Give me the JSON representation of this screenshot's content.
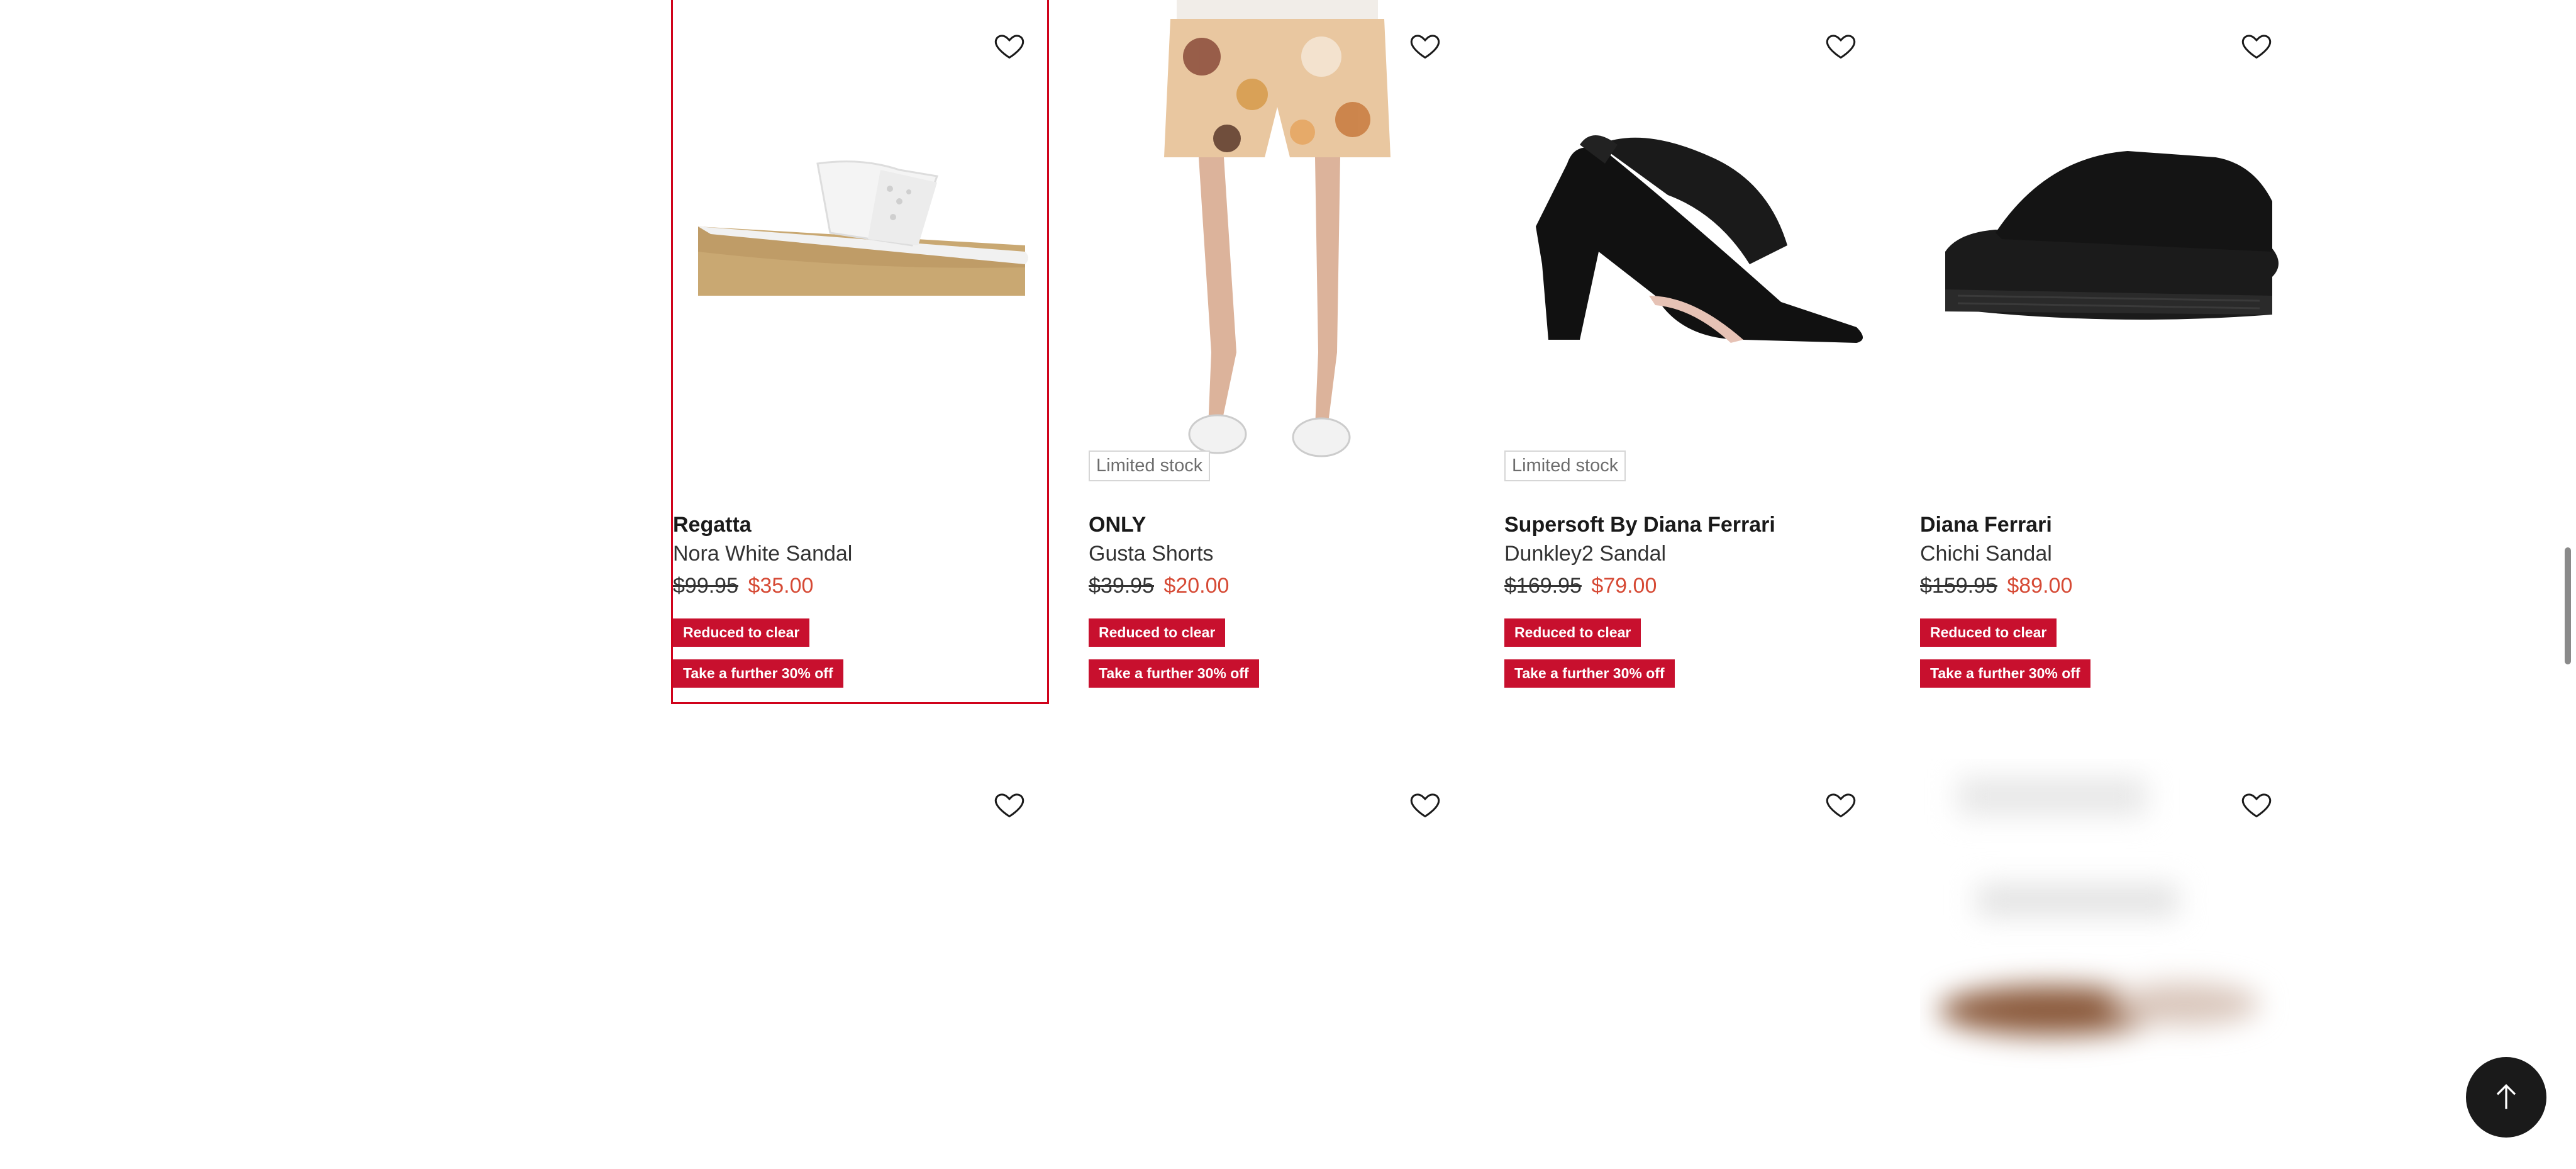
{
  "products": [
    {
      "brand": "Regatta",
      "name": "Nora White Sandal",
      "was": "$99.95",
      "now": "$35.00",
      "limited": "",
      "badges": [
        "Reduced to clear",
        "Take a further 30% off"
      ]
    },
    {
      "brand": "ONLY",
      "name": "Gusta Shorts",
      "was": "$39.95",
      "now": "$20.00",
      "limited": "Limited stock",
      "badges": [
        "Reduced to clear",
        "Take a further 30% off"
      ]
    },
    {
      "brand": "Supersoft By Diana Ferrari",
      "name": "Dunkley2 Sandal",
      "was": "$169.95",
      "now": "$79.00",
      "limited": "Limited stock",
      "badges": [
        "Reduced to clear",
        "Take a further 30% off"
      ]
    },
    {
      "brand": "Diana Ferrari",
      "name": "Chichi Sandal",
      "was": "$159.95",
      "now": "$89.00",
      "limited": "",
      "badges": [
        "Reduced to clear",
        "Take a further 30% off"
      ]
    }
  ],
  "colors": {
    "badge": "#c8102e",
    "sale_price": "#d64a35",
    "focus_outline": "#d0021b"
  },
  "icons": {
    "wishlist": "heart-outline-icon",
    "back_to_top": "arrow-up-icon"
  }
}
